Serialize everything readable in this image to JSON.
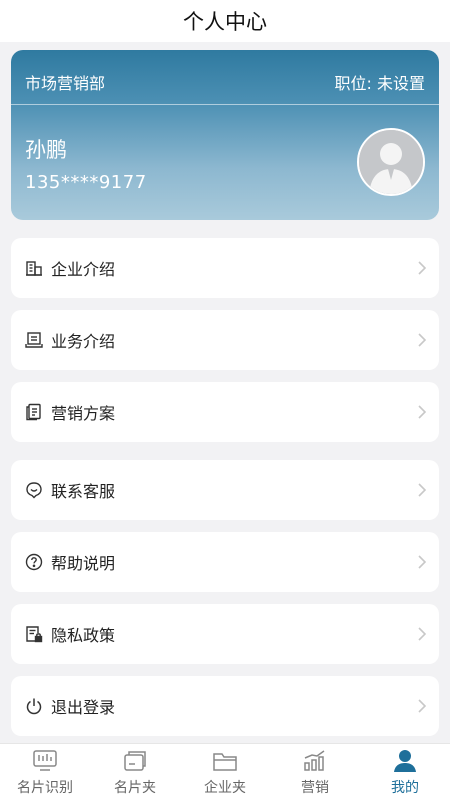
{
  "header": {
    "title": "个人中心"
  },
  "profile": {
    "department": "市场营销部",
    "position": "职位: 未设置",
    "name": "孙鹏",
    "phone": "135****9177"
  },
  "menu": [
    {
      "label": "企业介绍",
      "icon": "building-icon"
    },
    {
      "label": "业务介绍",
      "icon": "business-icon"
    },
    {
      "label": "营销方案",
      "icon": "document-icon"
    },
    {
      "label": "联系客服",
      "icon": "chat-icon"
    },
    {
      "label": "帮助说明",
      "icon": "help-icon"
    },
    {
      "label": "隐私政策",
      "icon": "privacy-icon"
    },
    {
      "label": "退出登录",
      "icon": "power-icon"
    }
  ],
  "tabs": [
    {
      "label": "名片识别",
      "icon": "scan-card-icon"
    },
    {
      "label": "名片夹",
      "icon": "card-holder-icon"
    },
    {
      "label": "企业夹",
      "icon": "folder-icon"
    },
    {
      "label": "营销",
      "icon": "chart-icon"
    },
    {
      "label": "我的",
      "icon": "person-icon",
      "active": true
    }
  ],
  "colors": {
    "accent": "#1e6f9a",
    "card_top": "#2f7aa0",
    "card_bottom": "#a9cadb"
  }
}
